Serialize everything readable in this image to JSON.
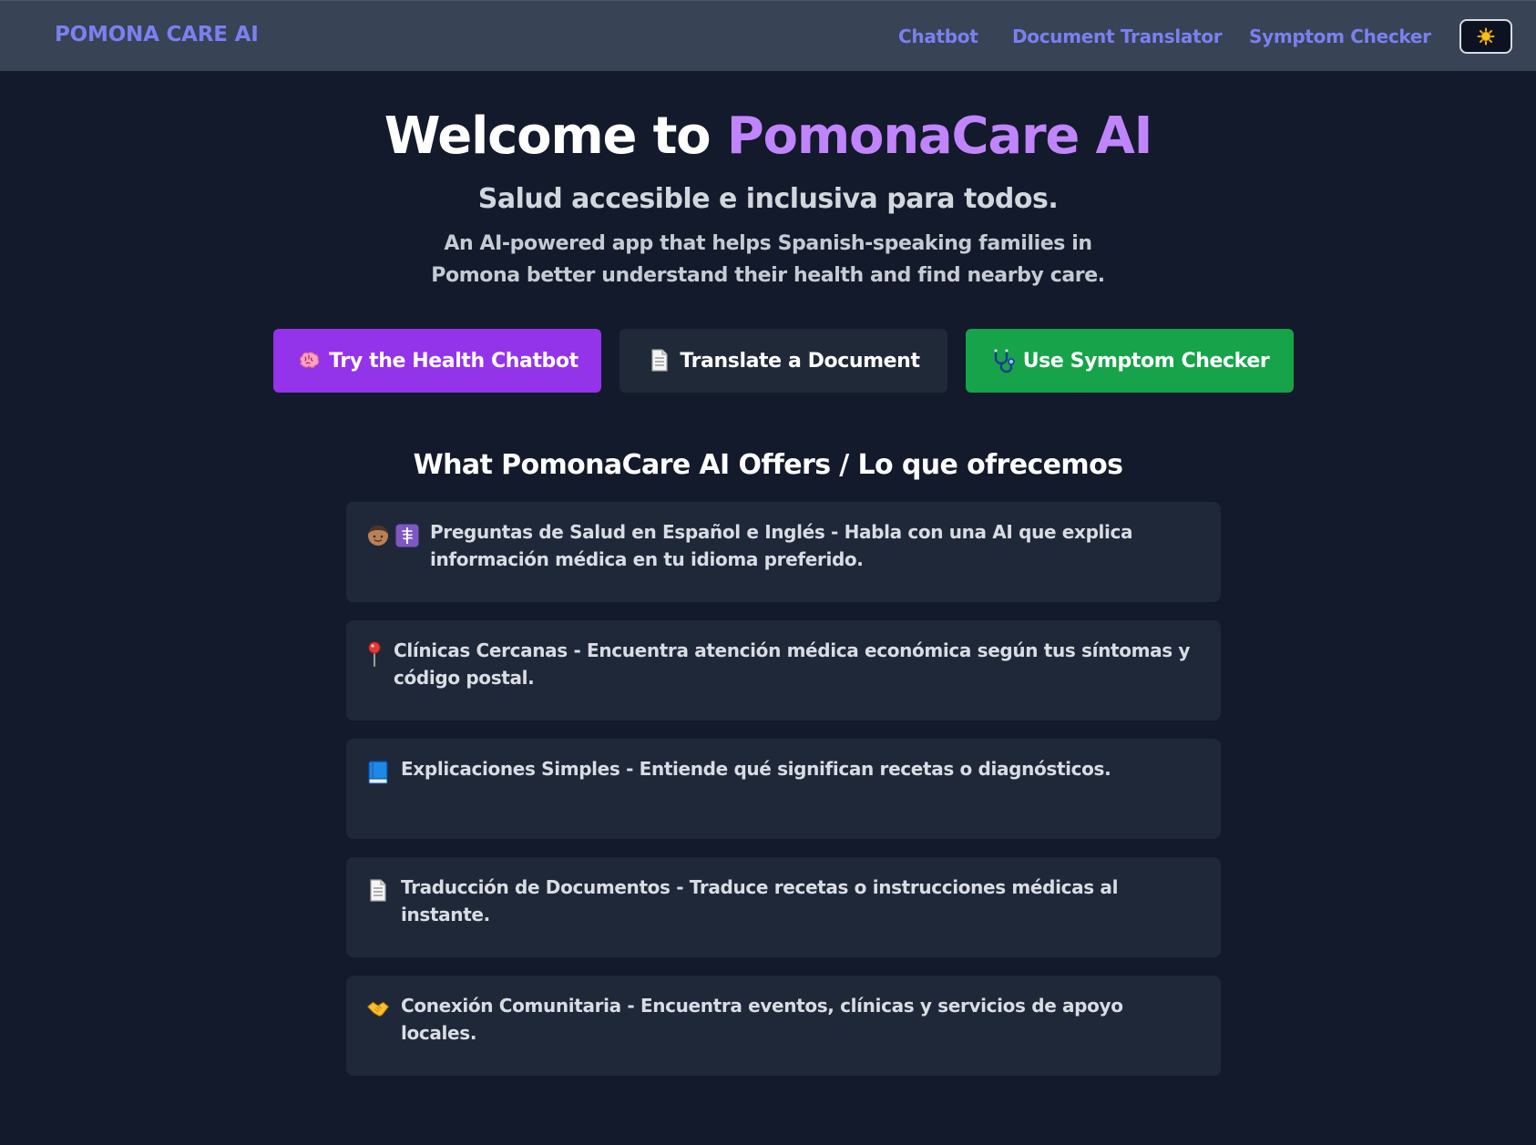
{
  "header": {
    "brand": "POMONA CARE AI",
    "nav": [
      {
        "label": "Chatbot"
      },
      {
        "label": "Document Translator"
      },
      {
        "label": "Symptom Checker"
      }
    ],
    "theme_toggle_icon": "sun-icon"
  },
  "hero": {
    "title_prefix": "Welcome to",
    "title_accent": "PomonaCare AI",
    "subtitle": "Salud accesible e inclusiva para todos.",
    "description": "An AI-powered app that helps Spanish-speaking families in Pomona better understand their health and find nearby care."
  },
  "cta": [
    {
      "label": "Try the Health Chatbot",
      "icon": "brain-icon",
      "color": "#9333ea"
    },
    {
      "label": "Translate a Document",
      "icon": "page-icon",
      "color": "#1f2937"
    },
    {
      "label": "Use Symptom Checker",
      "icon": "stethoscope-icon",
      "color": "#16a34a"
    }
  ],
  "features": {
    "heading": "What PomonaCare AI Offers / Lo que ofrecemos",
    "items": [
      {
        "text": "Preguntas de Salud en Español e Inglés - Habla con una AI que explica información médica en tu idioma preferido.",
        "icons": [
          "person-icon",
          "medical-symbol-icon"
        ]
      },
      {
        "text": "Clínicas Cercanas - Encuentra atención médica económica según tus síntomas y código postal.",
        "icons": [
          "pin-icon"
        ]
      },
      {
        "text": "Explicaciones Simples - Entiende qué significan recetas o diagnósticos.",
        "icons": [
          "book-icon"
        ]
      },
      {
        "text": "Traducción de Documentos - Traduce recetas o instrucciones médicas al instante.",
        "icons": [
          "page-icon"
        ]
      },
      {
        "text": "Conexión Comunitaria - Encuentra eventos, clínicas y servicios de apoyo locales.",
        "icons": [
          "handshake-icon"
        ]
      }
    ]
  },
  "colors": {
    "background": "#121a2b",
    "navbar": "#384356",
    "brand": "#7b80f0",
    "accent": "#c084fc",
    "card": "#1f2839"
  }
}
